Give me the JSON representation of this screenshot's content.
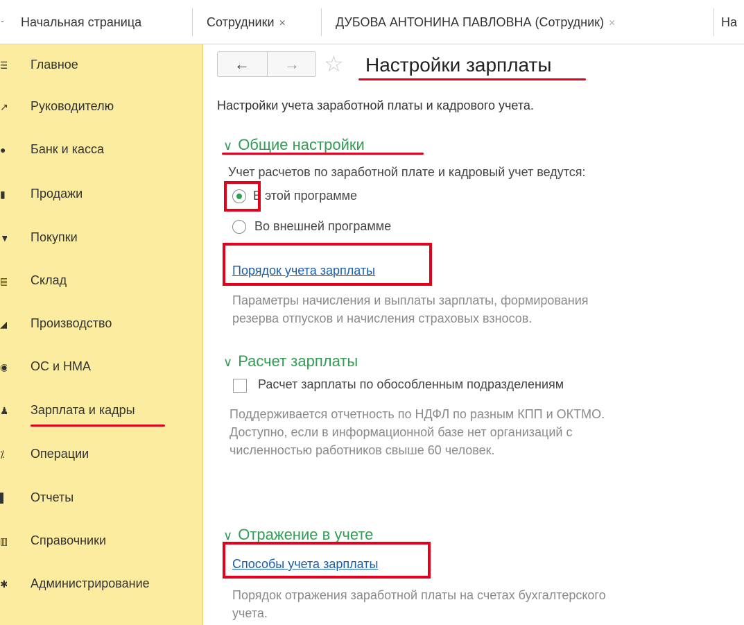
{
  "tabs": [
    {
      "label": "Начальная страница",
      "close": ""
    },
    {
      "label": "Сотрудники",
      "close": "×"
    },
    {
      "label": "ДУБОВА АНТОНИНА ПАВЛОВНА (Сотрудник)",
      "close": "×"
    },
    {
      "label": "На",
      "close": ""
    }
  ],
  "sidebar": {
    "items": [
      {
        "label": "Главное",
        "icon": "menu-lines-icon"
      },
      {
        "label": "Руководителю",
        "icon": "arrow-icon"
      },
      {
        "label": "Банк и касса",
        "icon": "bank-icon"
      },
      {
        "label": "Продажи",
        "icon": "sales-icon"
      },
      {
        "label": "Покупки",
        "icon": "purchases-icon"
      },
      {
        "label": "Склад",
        "icon": "warehouse-icon"
      },
      {
        "label": "Производство",
        "icon": "production-icon"
      },
      {
        "label": "ОС и НМА",
        "icon": "assets-icon"
      },
      {
        "label": "Зарплата и кадры",
        "icon": "person-icon"
      },
      {
        "label": "Операции",
        "icon": "operations-icon"
      },
      {
        "label": "Отчеты",
        "icon": "reports-icon"
      },
      {
        "label": "Справочники",
        "icon": "reference-icon"
      },
      {
        "label": "Администрирование",
        "icon": "gear-icon"
      }
    ]
  },
  "page": {
    "title": "Настройки зарплаты",
    "subtitle": "Настройки учета заработной платы и кадрового учета.",
    "back_arrow": "←",
    "forward_arrow": "→",
    "star": "☆"
  },
  "general": {
    "title": "Общие настройки",
    "question": "Учет расчетов по заработной плате и кадровый учет ведутся:",
    "option_internal": "В этой программе",
    "option_external": "Во внешней программе",
    "selected": "internal",
    "link": "Порядок учета зарплаты",
    "link_hint_1": "Параметры начисления и выплаты зарплаты, формирования",
    "link_hint_2": "резерва отпусков и начисления страховых взносов."
  },
  "payroll": {
    "title": "Расчет зарплаты",
    "checkbox_label": "Расчет зарплаты по обособленным подразделениям",
    "checked": false,
    "hint_1": "Поддерживается отчетность по НДФЛ по разным КПП и ОКТМО.",
    "hint_2": "Доступно, если в информационной базе нет организаций с",
    "hint_3": "численностью работников свыше 60 человек."
  },
  "accounting": {
    "title": "Отражение в учете",
    "link": "Способы учета зарплаты",
    "hint_1": "Порядок отражения заработной платы на счетах бухгалтерского",
    "hint_2": "учета."
  },
  "colors": {
    "sidebar_bg": "#fbec9f",
    "section_green": "#2f9e52",
    "link_blue": "#1a5ea8",
    "annotation_red": "#e4001b"
  }
}
